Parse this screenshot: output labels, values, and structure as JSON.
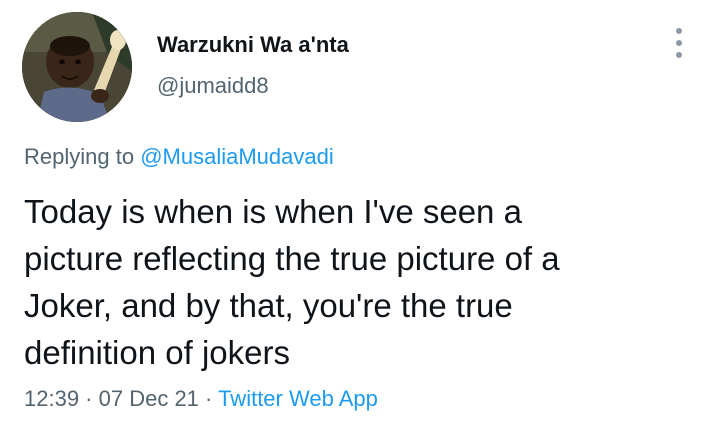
{
  "author": {
    "display_name": "Warzukni Wa a'nta",
    "handle": "@jumaidd8"
  },
  "reply": {
    "prefix": "Replying to",
    "mention": "@MusaliaMudavadi"
  },
  "tweet": {
    "lines": [
      "Today is when is when I've seen a",
      "picture reflecting the true picture of a",
      "Joker, and by that, you're the true",
      "definition of jokers"
    ]
  },
  "meta": {
    "time": "12:39",
    "separator": " · ",
    "date": "07 Dec 21",
    "source": "Twitter Web App"
  },
  "icons": {
    "more": "more-vertical-icon"
  },
  "colors": {
    "text": "#0f1419",
    "secondary": "#536471",
    "link": "#1d9bf0"
  }
}
